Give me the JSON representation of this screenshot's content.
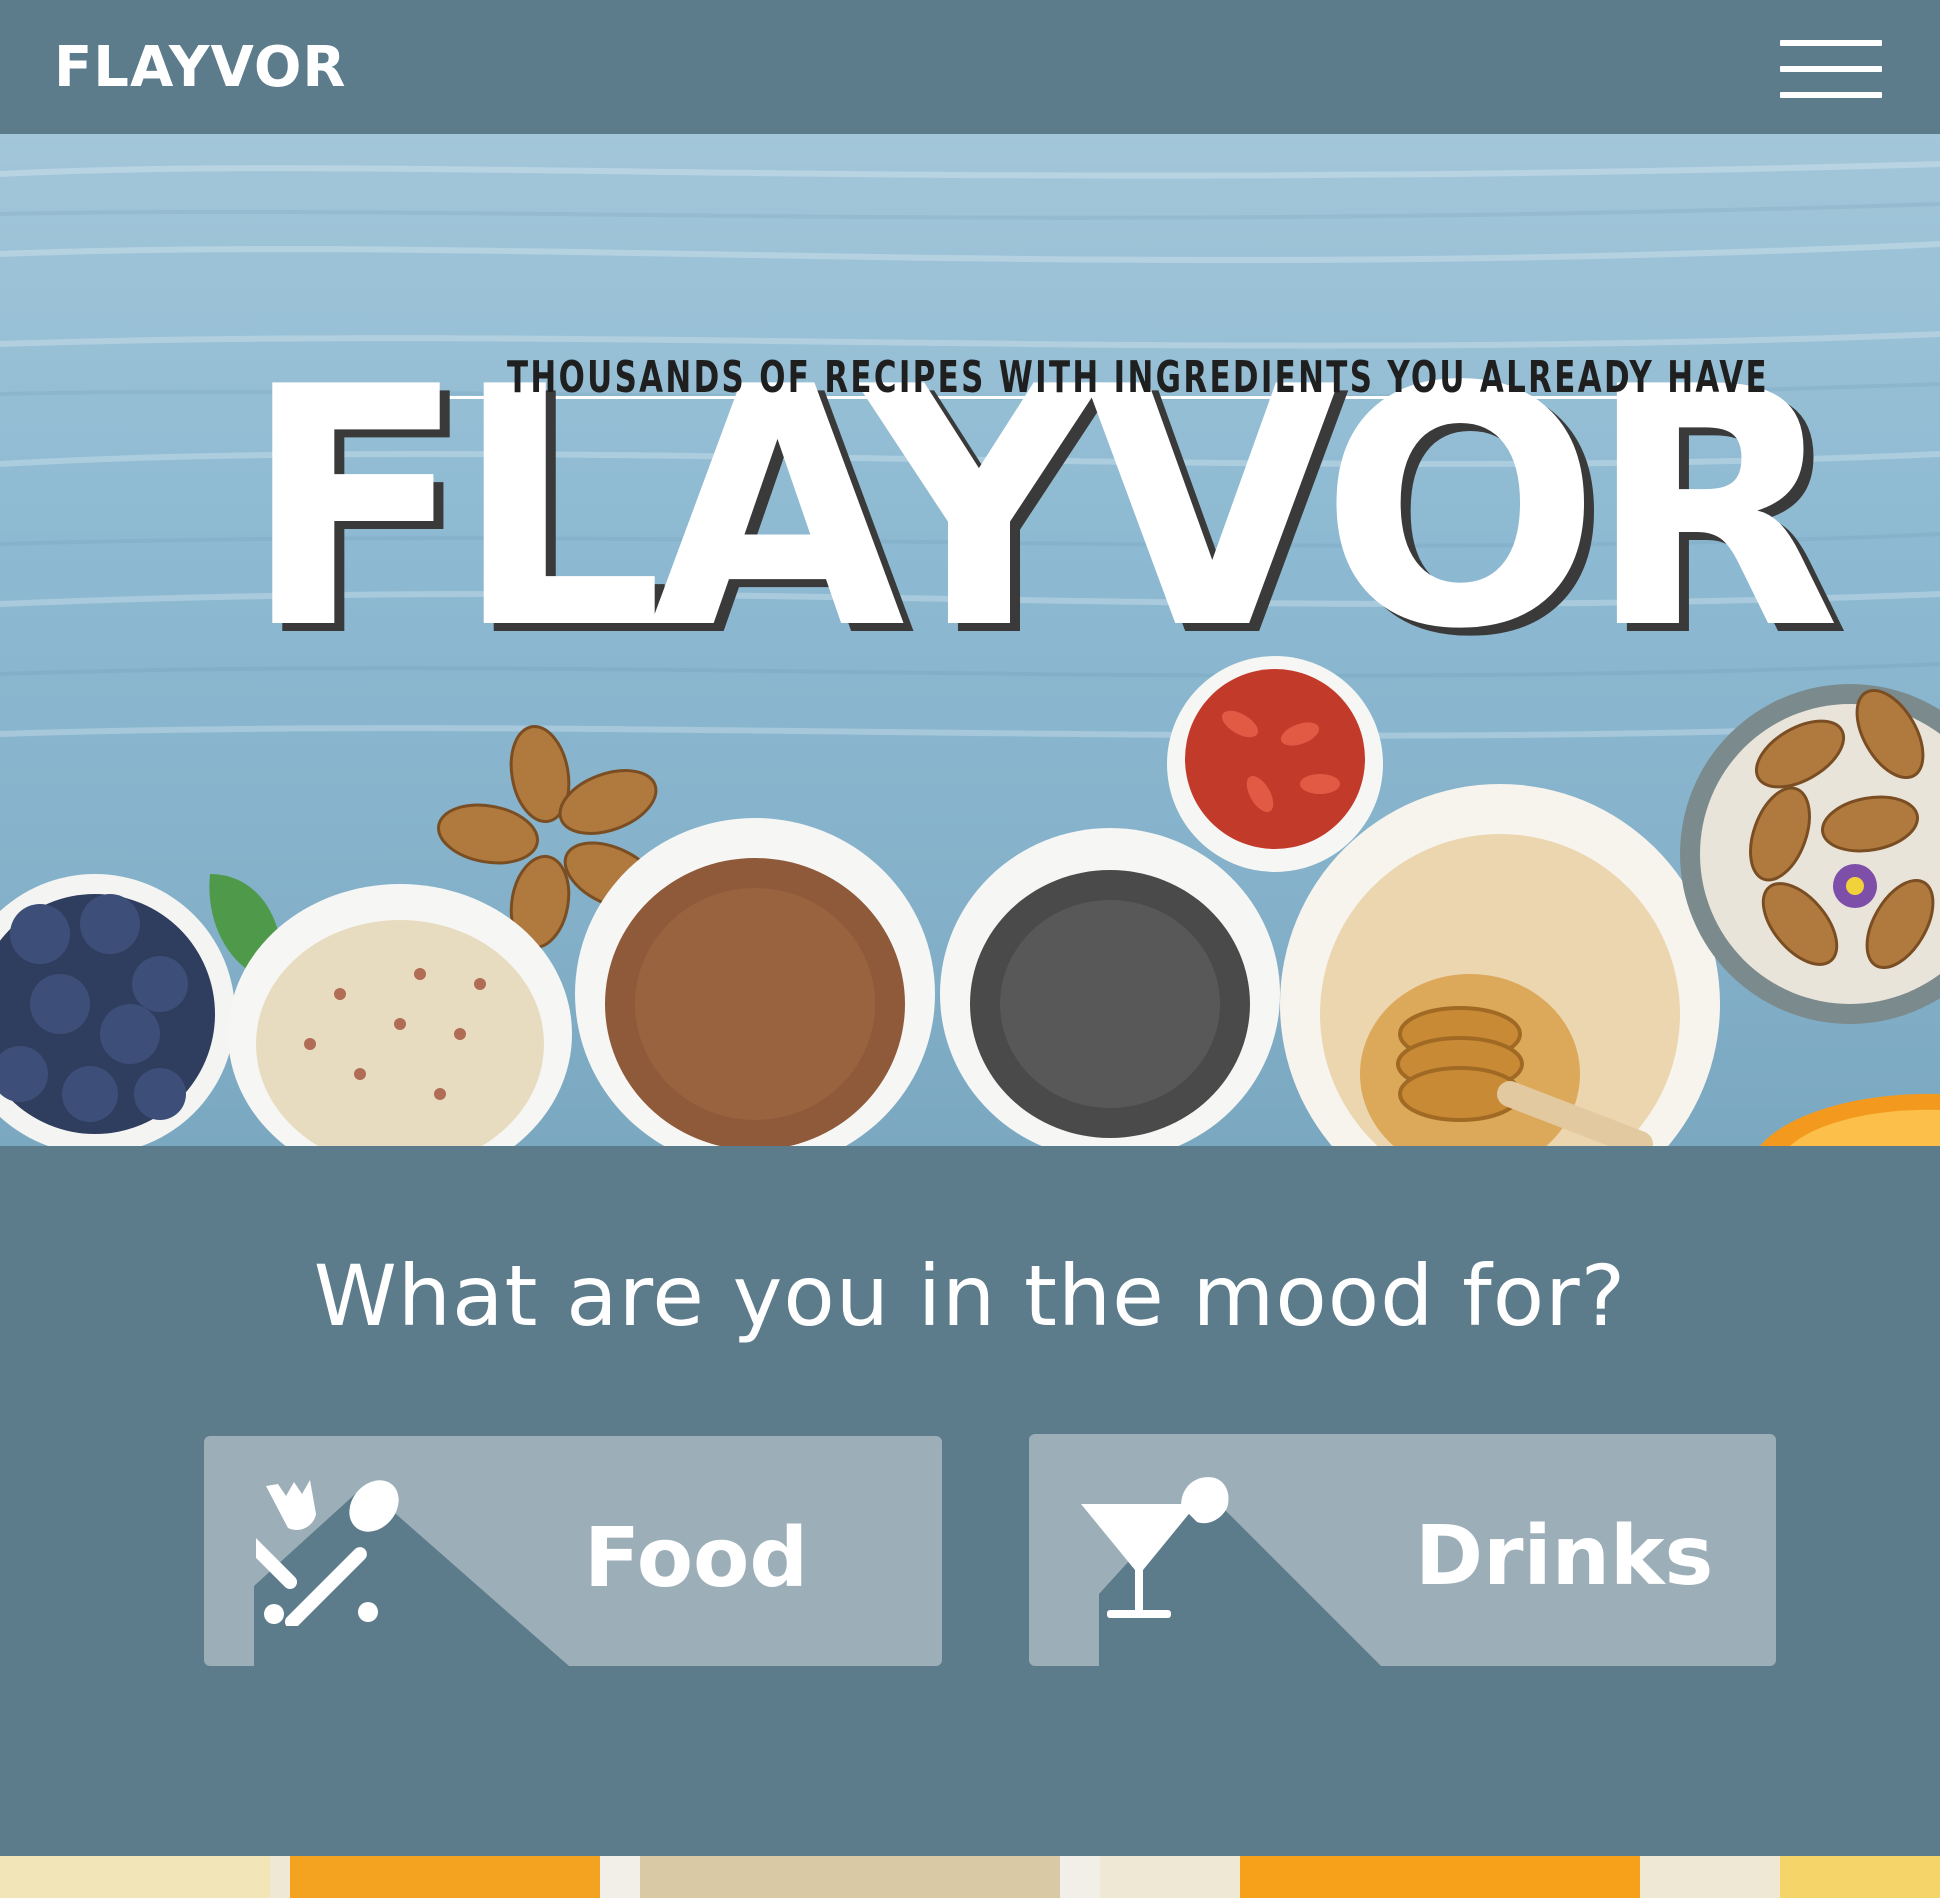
{
  "header": {
    "brand": "FLAYVOR",
    "menu_icon": "hamburger-menu-icon"
  },
  "hero": {
    "tagline": "THOUSANDS OF RECIPES WITH INGREDIENTS YOU ALREADY HAVE",
    "title": "FLAYVOR"
  },
  "mood": {
    "question": "What are you in the mood for?",
    "food": {
      "label": "Food",
      "icon": "fork-spoon-icon"
    },
    "drinks": {
      "label": "Drinks",
      "icon": "cocktail-glass-icon"
    }
  },
  "colors": {
    "primary": "#5c7b8b",
    "button": "#9caeb7",
    "text": "#ffffff"
  }
}
